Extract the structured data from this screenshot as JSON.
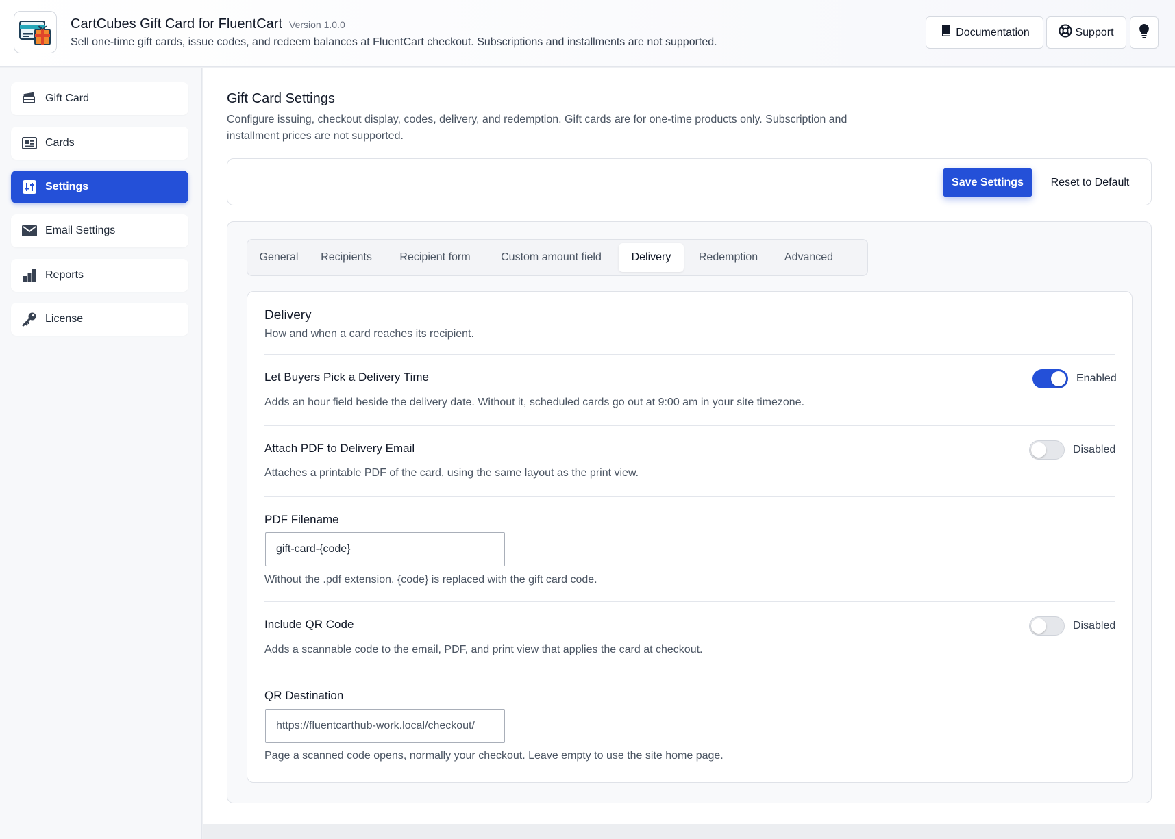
{
  "header": {
    "app_title": "CartCubes Gift Card for FluentCart",
    "version": "Version 1.0.0",
    "description": "Sell one-time gift cards, issue codes, and redeem balances at FluentCart checkout. Subscriptions and installments are not supported.",
    "documentation_label": "Documentation",
    "support_label": "Support"
  },
  "sidebar": {
    "items": [
      {
        "label": "Gift Card",
        "icon": "gift-card-stack-icon"
      },
      {
        "label": "Cards",
        "icon": "id-card-icon"
      },
      {
        "label": "Settings",
        "icon": "sliders-icon",
        "active": true
      },
      {
        "label": "Email Settings",
        "icon": "envelope-icon"
      },
      {
        "label": "Reports",
        "icon": "bar-chart-icon"
      },
      {
        "label": "License",
        "icon": "key-icon"
      }
    ]
  },
  "page": {
    "title": "Gift Card Settings",
    "description": "Configure issuing, checkout display, codes, delivery, and redemption. Gift cards are for one-time products only. Subscription and installment prices are not supported."
  },
  "actions": {
    "save_label": "Save Settings",
    "reset_label": "Reset to Default"
  },
  "tabs": [
    {
      "label": "General"
    },
    {
      "label": "Recipients"
    },
    {
      "label": "Recipient form"
    },
    {
      "label": "Custom amount field"
    },
    {
      "label": "Delivery",
      "active": true
    },
    {
      "label": "Redemption"
    },
    {
      "label": "Advanced"
    }
  ],
  "delivery": {
    "title": "Delivery",
    "subtitle": "How and when a card reaches its recipient.",
    "pick_time": {
      "label": "Let Buyers Pick a Delivery Time",
      "help": "Adds an hour field beside the delivery date. Without it, scheduled cards go out at 9:00 am in your site timezone.",
      "state_label": "Enabled",
      "enabled": true
    },
    "attach_pdf": {
      "label": "Attach PDF to Delivery Email",
      "help": "Attaches a printable PDF of the card, using the same layout as the print view.",
      "state_label": "Disabled",
      "enabled": false
    },
    "pdf_filename": {
      "label": "PDF Filename",
      "value": "gift-card-{code}",
      "help": "Without the .pdf extension. {code} is replaced with the gift card code."
    },
    "qr_code": {
      "label": "Include QR Code",
      "help": "Adds a scannable code to the email, PDF, and print view that applies the card at checkout.",
      "state_label": "Disabled",
      "enabled": false
    },
    "qr_destination": {
      "label": "QR Destination",
      "placeholder": "https://fluentcarthub-work.local/checkout/",
      "help": "Page a scanned code opens, normally your checkout. Leave empty to use the site home page."
    }
  },
  "colors": {
    "accent": "#2450d8",
    "toggle_off": "#e5e7eb"
  }
}
